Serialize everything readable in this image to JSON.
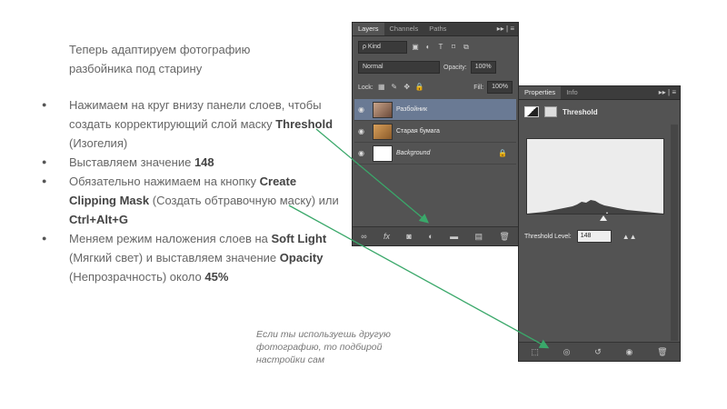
{
  "intro": "Теперь адаптируем фотографию разбойника под старину",
  "steps": [
    {
      "before": "Нажимаем на круг внизу панели слоев, чтобы создать корректирующий слой маску ",
      "bold": "Threshold",
      "after": " (Изогелия)"
    },
    {
      "before": "Выставляем значение ",
      "bold": "148",
      "after": ""
    },
    {
      "before": "Обязательно нажимаем на кнопку ",
      "bold": "Create Clipping Mask",
      "mid": " (Создать обтравочную маску) или ",
      "bold2": "Ctrl+Alt+G",
      "after": ""
    },
    {
      "before": "Меняем режим наложения слоев на  ",
      "bold": "Soft Light",
      "mid": " (Мягкий свет) и выставляем значение ",
      "bold2": "Opacity",
      "mid2": " (Непрозрачность) около ",
      "bold3": "45%"
    }
  ],
  "note": "Если ты используешь другую фотографию, то подбирой настройки сам",
  "layers_panel": {
    "tabs": [
      "Layers",
      "Channels",
      "Paths"
    ],
    "menu": "▸▸ | ≡",
    "kind_label": "ρ Kind",
    "blend_mode": "Normal",
    "opacity_label": "Opacity:",
    "opacity_value": "100%",
    "lock_label": "Lock:",
    "fill_label": "Fill:",
    "fill_value": "100%",
    "layers": [
      {
        "name": "Разбойник",
        "selected": true
      },
      {
        "name": "Старая бумага",
        "selected": false
      },
      {
        "name": "Background",
        "selected": false
      }
    ],
    "bottom_icons": [
      "link-icon",
      "fx-icon",
      "mask-icon",
      "adjustment-circle-icon",
      "folder-icon",
      "new-layer-icon",
      "trash-icon"
    ]
  },
  "properties_panel": {
    "tabs": [
      "Properties",
      "Info"
    ],
    "menu": "▸▸ | ≡",
    "title": "Threshold",
    "threshold_label": "Threshold Level:",
    "threshold_value": "148",
    "bottom_icons": [
      "clip-mask-icon",
      "eye-previous-icon",
      "reset-icon",
      "visibility-icon",
      "trash-icon"
    ]
  },
  "colors": {
    "panel_bg": "#535353",
    "selected_layer": "#6a7a94",
    "arrow": "#3aa86a"
  }
}
